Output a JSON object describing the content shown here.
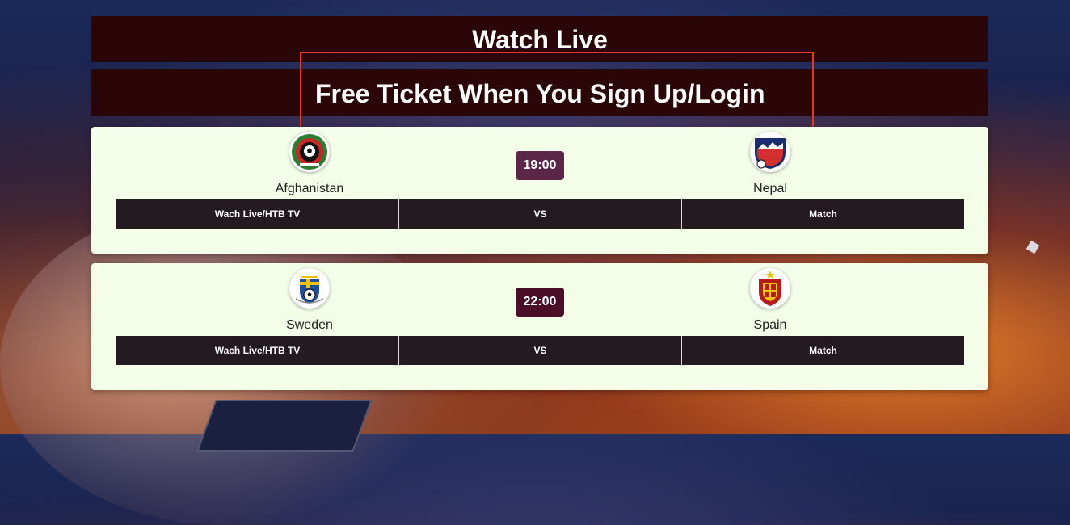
{
  "header": {
    "title": "Watch Live",
    "promo": "Free Ticket When You Sign Up/Login"
  },
  "matches": [
    {
      "home": {
        "name": "Afghanistan",
        "logo_icon": "afghanistan-team-logo"
      },
      "away": {
        "name": "Nepal",
        "logo_icon": "nepal-team-logo"
      },
      "time": "19:00",
      "time_color": "#5a2748",
      "bar": {
        "watch": "Wach Live/HTB TV",
        "vs": "VS",
        "match": "Match"
      }
    },
    {
      "home": {
        "name": "Sweden",
        "logo_icon": "sweden-team-logo"
      },
      "away": {
        "name": "Spain",
        "logo_icon": "spain-team-logo"
      },
      "time": "22:00",
      "time_color": "#4a0e26",
      "bar": {
        "watch": "Wach Live/HTB TV",
        "vs": "VS",
        "match": "Match"
      }
    }
  ],
  "colors": {
    "banner_bg": "#2a0608",
    "card_bg": "#f3fde8",
    "bar_bg": "#231a22",
    "highlight_border": "#e03a20"
  }
}
